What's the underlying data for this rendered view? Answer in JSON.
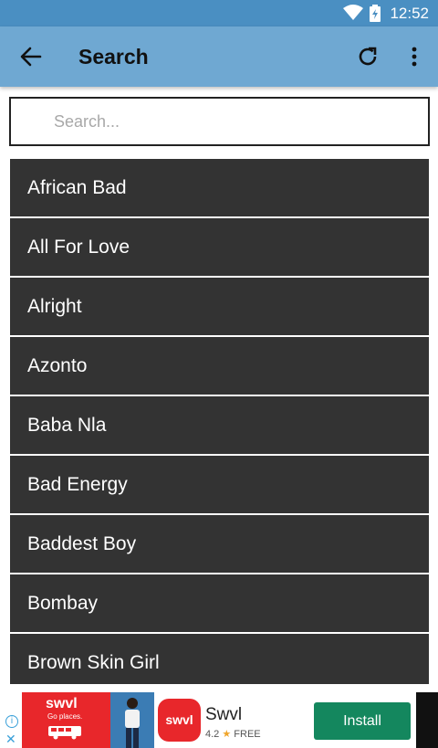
{
  "status_bar": {
    "time": "12:52"
  },
  "app_bar": {
    "title": "Search"
  },
  "search": {
    "placeholder": "Search..."
  },
  "songs": [
    "African Bad",
    "All For Love",
    "Alright",
    "Azonto",
    "Baba Nla",
    "Bad Energy",
    "Baddest Boy",
    "Bombay",
    "Brown Skin Girl"
  ],
  "ad": {
    "brand": "swvl",
    "tagline": "Go places.",
    "app_name": "Swvl",
    "rating": "4.2",
    "price": "FREE",
    "install_label": "Install",
    "info_label": "i",
    "close_label": "✕"
  },
  "colors": {
    "status_bar": "#4a8fc2",
    "app_bar": "#6fa8d2",
    "list_item": "#333333",
    "ad_red": "#e8272b",
    "install_green": "#14875e"
  }
}
